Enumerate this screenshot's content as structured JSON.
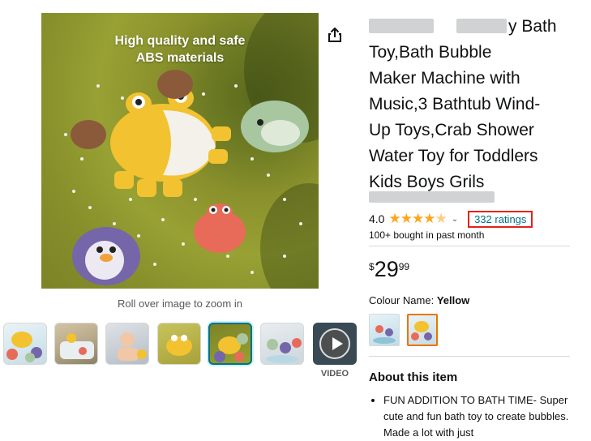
{
  "main_image": {
    "overlay_line1": "High quality and safe",
    "overlay_line2": "ABS materials"
  },
  "zoom_hint": "Roll over image to zoom in",
  "video_label": "VIDEO",
  "product": {
    "title_line1": "Toy,Bath Bubble",
    "title_line2": "Maker Machine with",
    "title_line3": "Music,3 Bathtub Wind-",
    "title_line4": "Up Toys,Crab Shower",
    "title_line5": "Water Toy for Toddlers",
    "title_line6": "Kids Boys Grils",
    "title_partial": "y Bath",
    "rating_value": "4.0",
    "stars": "★★★★",
    "half_star": "★",
    "ratings_link": "332 ratings",
    "bought": "100+ bought in past month",
    "price_symbol": "$",
    "price_whole": "29",
    "price_fraction": "99",
    "colour_label": "Colour Name:",
    "colour_value": "Yellow",
    "about_heading": "About this item",
    "bullets": [
      "FUN ADDITION TO BATH TIME- Super cute and fun bath toy to create bubbles. Made a lot with just"
    ]
  },
  "colors": {
    "link": "#007185",
    "star": "#ffa41c",
    "highlight_box": "#e3221b",
    "selected_thumb": "#007185",
    "selected_swatch": "#e77600"
  }
}
